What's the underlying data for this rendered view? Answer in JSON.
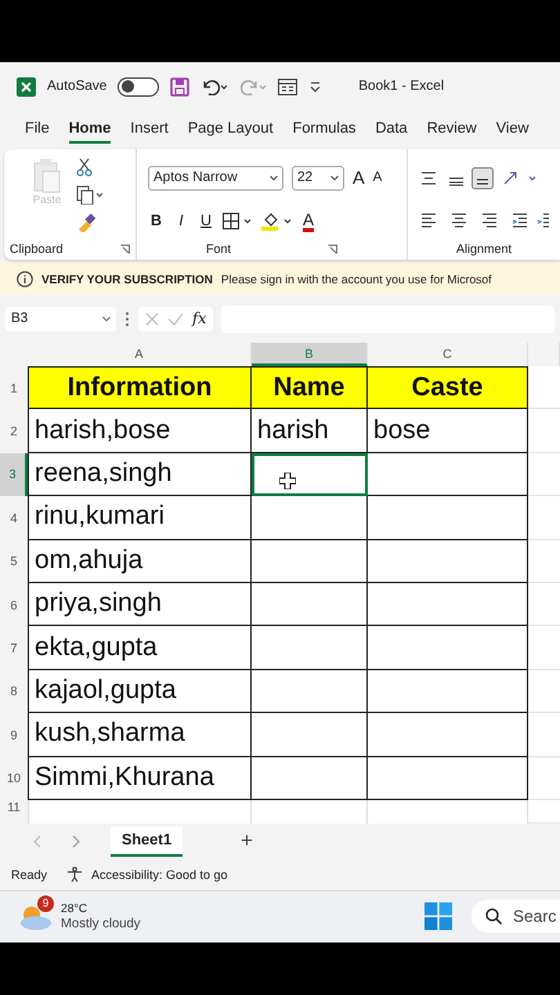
{
  "title_bar": {
    "autosave_label": "AutoSave",
    "autosave_on": false,
    "title": "Book1  -  Excel"
  },
  "menu_tabs": [
    {
      "label": "File",
      "selected": false
    },
    {
      "label": "Home",
      "selected": true
    },
    {
      "label": "Insert",
      "selected": false
    },
    {
      "label": "Page Layout",
      "selected": false
    },
    {
      "label": "Formulas",
      "selected": false
    },
    {
      "label": "Data",
      "selected": false
    },
    {
      "label": "Review",
      "selected": false
    },
    {
      "label": "View",
      "selected": false
    }
  ],
  "ribbon": {
    "paste_label": "Paste",
    "paste_disabled": true,
    "font_name": "Aptos Narrow",
    "font_size": "22",
    "grow_font": "A",
    "shrink_font": "A",
    "format_buttons": [
      "B",
      "I",
      "U"
    ],
    "font_color_label": "A",
    "groups": [
      "Clipboard",
      "Font",
      "Alignment"
    ]
  },
  "notice": {
    "title": "VERIFY YOUR SUBSCRIPTION",
    "message": "Please sign in with the account you use for Microsof"
  },
  "formula_bar": {
    "name_box": "B3",
    "function_symbol": "fx"
  },
  "sheet": {
    "columns": [
      {
        "label": "A",
        "selected": false
      },
      {
        "label": "B",
        "selected": true
      },
      {
        "label": "C",
        "selected": false
      }
    ],
    "rows": [
      {
        "label": "1",
        "selected": false,
        "kind": "header",
        "cells": [
          "Information",
          "Name",
          "Caste"
        ]
      },
      {
        "label": "2",
        "selected": false,
        "kind": "data",
        "cells": [
          "harish,bose",
          "harish",
          "bose"
        ]
      },
      {
        "label": "3",
        "selected": true,
        "kind": "data",
        "cells": [
          "reena,singh",
          "",
          ""
        ]
      },
      {
        "label": "4",
        "selected": false,
        "kind": "data",
        "cells": [
          "rinu,kumari",
          "",
          ""
        ]
      },
      {
        "label": "5",
        "selected": false,
        "kind": "data",
        "cells": [
          "om,ahuja",
          "",
          ""
        ]
      },
      {
        "label": "6",
        "selected": false,
        "kind": "data",
        "cells": [
          "priya,singh",
          "",
          ""
        ]
      },
      {
        "label": "7",
        "selected": false,
        "kind": "data",
        "cells": [
          "ekta,gupta",
          "",
          ""
        ]
      },
      {
        "label": "8",
        "selected": false,
        "kind": "data",
        "cells": [
          "kajaol,gupta",
          "",
          ""
        ]
      },
      {
        "label": "9",
        "selected": false,
        "kind": "data",
        "cells": [
          "kush,sharma",
          "",
          ""
        ]
      },
      {
        "label": "10",
        "selected": false,
        "kind": "data",
        "cells": [
          "Simmi,Khurana",
          "",
          ""
        ]
      },
      {
        "label": "11",
        "selected": false,
        "kind": "partial",
        "cells": [
          "",
          "",
          ""
        ]
      }
    ]
  },
  "sheet_tabs": [
    {
      "label": "Sheet1",
      "selected": true
    }
  ],
  "add_sheet": "+",
  "status_bar": {
    "status": "Ready",
    "accessibility": "Accessibility: Good to go"
  },
  "taskbar": {
    "weather_badge": "9",
    "temperature": "28°C",
    "weather": "Mostly cloudy",
    "search_text": "Searc"
  }
}
